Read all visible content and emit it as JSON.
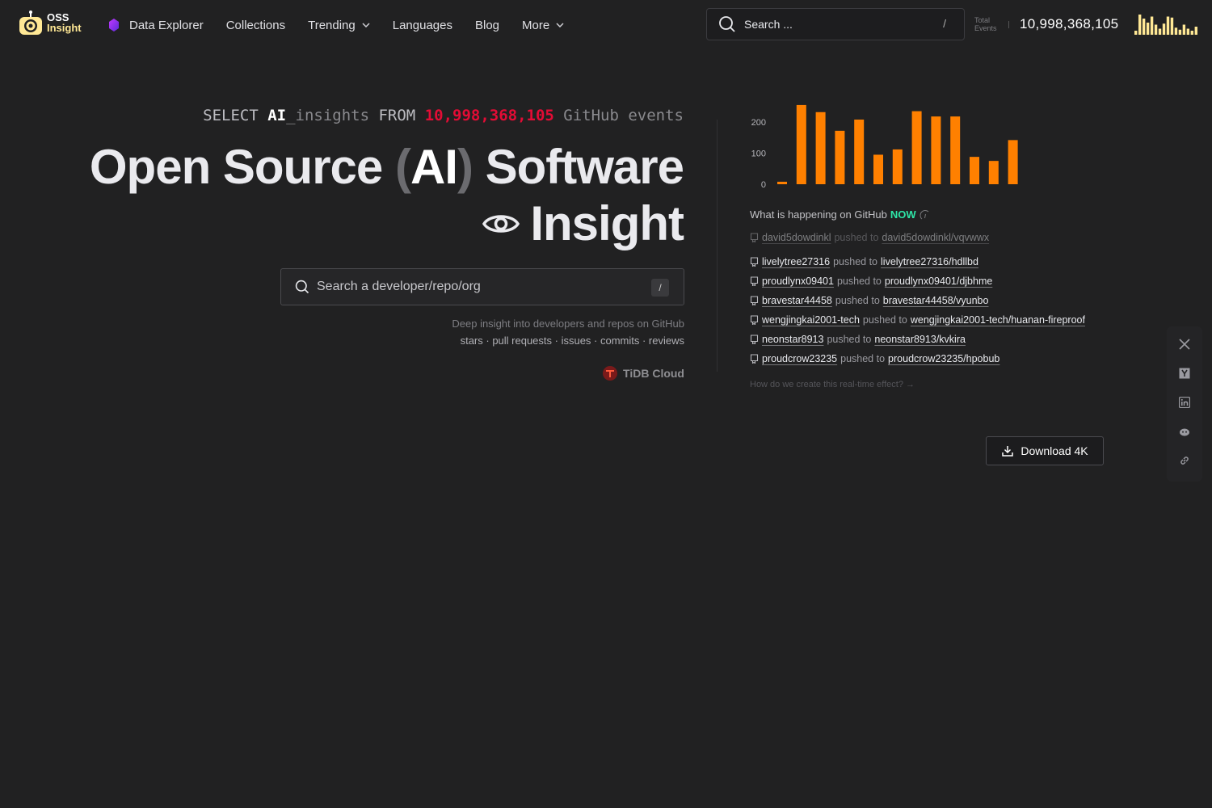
{
  "nav": {
    "logo_line1": "OSS",
    "logo_line2": "Insight",
    "links": [
      {
        "label": "Data Explorer",
        "has_icon": true
      },
      {
        "label": "Collections"
      },
      {
        "label": "Trending",
        "dropdown": true
      },
      {
        "label": "Languages"
      },
      {
        "label": "Blog"
      },
      {
        "label": "More",
        "dropdown": true
      }
    ],
    "search_placeholder": "Search ...",
    "search_shortcut": "/",
    "total_label_1": "Total",
    "total_label_2": "Events",
    "total_count": "10,998,368,105"
  },
  "hero": {
    "sql_select": "SELECT ",
    "sql_ai": "AI",
    "sql_insights": "_insights",
    "sql_from": " FROM ",
    "sql_count": "10,998,368,105",
    "sql_tail": " GitHub events",
    "title_part1": "Open Source ",
    "title_open_paren": "(",
    "title_ai": "AI",
    "title_close_paren": ")",
    "title_part2": " Software",
    "title_line2": "Insight",
    "search_placeholder": "Search a developer/repo/org",
    "search_shortcut": "/",
    "desc_line1": "Deep insight into developers and repos on GitHub",
    "desc_line2": "stars · pull requests · issues · commits · reviews",
    "powered_by": "TiDB Cloud"
  },
  "realtime": {
    "title_prefix": "What is happening on GitHub ",
    "title_now": "NOW",
    "pushed_to": "pushed to",
    "events": [
      {
        "user": "david5dowdinkl",
        "repo": "david5dowdinkl/vqvwwx",
        "faded": true
      },
      {
        "user": "livelytree27316",
        "repo": "livelytree27316/hdllbd"
      },
      {
        "user": "proudlynx09401",
        "repo": "proudlynx09401/djbhme"
      },
      {
        "user": "bravestar44458",
        "repo": "bravestar44458/vyunbo"
      },
      {
        "user": "wengjingkai2001-tech",
        "repo": "wengjingkai2001-tech/huanan-fireproof"
      },
      {
        "user": "neonstar8913",
        "repo": "neonstar8913/kvkira"
      },
      {
        "user": "proudcrow23235",
        "repo": "proudcrow23235/hpobub"
      }
    ],
    "how_link": "How do we create this real-time effect? →"
  },
  "download_label": "Download 4K",
  "colors": {
    "background": "#212122",
    "accent_bar": "#ff8000",
    "sql_number": "#e30c35",
    "now_green": "#2ee6a8",
    "mini_bar": "#ffe895"
  },
  "chart_data": {
    "type": "bar",
    "y_ticks": [
      "200",
      "100",
      "0"
    ],
    "ylim": [
      0,
      260
    ],
    "values": [
      8,
      255,
      232,
      172,
      208,
      95,
      112,
      235,
      218,
      218,
      88,
      75,
      142
    ]
  },
  "mini_chart": {
    "values": [
      0.2,
      1.0,
      0.8,
      0.6,
      0.9,
      0.5,
      0.3,
      0.55,
      0.9,
      0.85,
      0.35,
      0.25,
      0.5,
      0.3,
      0.2,
      0.4
    ]
  }
}
